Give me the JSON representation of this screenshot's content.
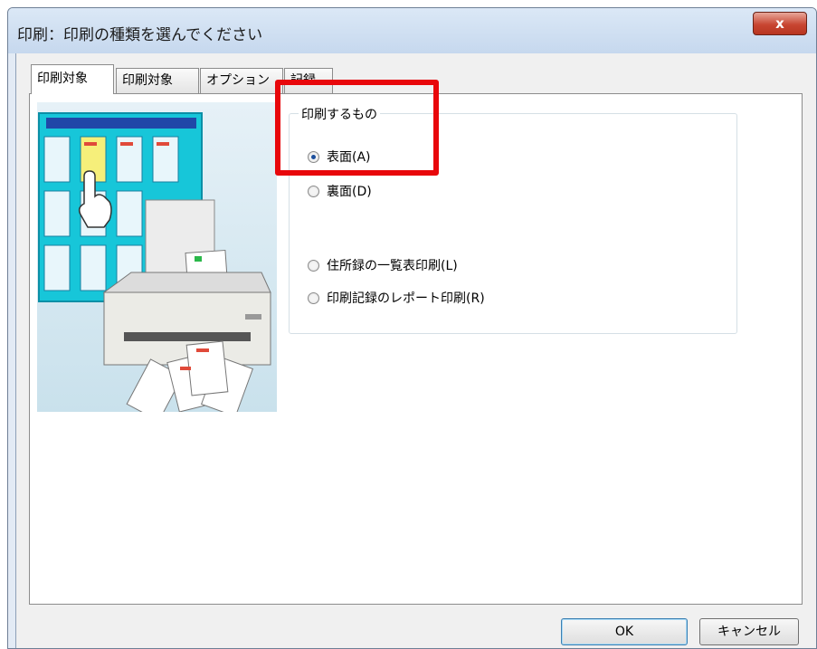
{
  "window": {
    "title": "印刷：印刷の種類を選んでください",
    "close_label": "x"
  },
  "tabs": [
    {
      "label": "印刷対象",
      "active": true
    },
    {
      "label": "印刷対象",
      "active": false
    },
    {
      "label": "オプション",
      "active": false
    },
    {
      "label": "記録",
      "active": false
    }
  ],
  "print_group": {
    "caption": "印刷するもの",
    "options": [
      {
        "label": "表面(A)",
        "checked": true
      },
      {
        "label": "裏面(D)",
        "checked": false
      },
      {
        "label": "住所録の一覧表印刷(L)",
        "checked": false
      },
      {
        "label": "印刷記録のレポート印刷(R)",
        "checked": false
      }
    ]
  },
  "buttons": {
    "ok": "OK",
    "cancel": "キャンセル"
  },
  "colors": {
    "highlight": "#e8070b",
    "title_gradient_top": "#dbe8f6",
    "close_button": "#c84632"
  }
}
